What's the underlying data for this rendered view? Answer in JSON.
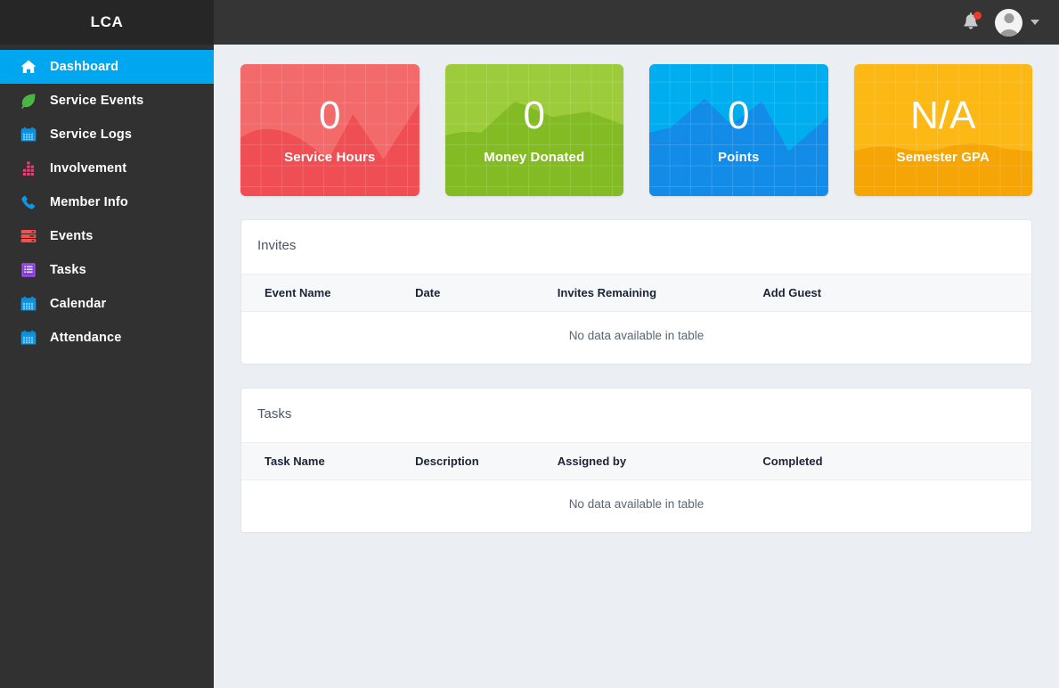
{
  "brand": {
    "name": "LCA"
  },
  "topbar": {
    "notifications_icon": "bell-icon",
    "has_unread": true,
    "avatar_icon": "user-avatar-icon",
    "dropdown_icon": "caret-down-icon"
  },
  "sidebar": {
    "items": [
      {
        "label": "Dashboard",
        "icon": "home-icon",
        "active": true
      },
      {
        "label": "Service Events",
        "icon": "leaf-icon",
        "active": false
      },
      {
        "label": "Service Logs",
        "icon": "calendar-icon",
        "active": false
      },
      {
        "label": "Involvement",
        "icon": "bar-chart-icon",
        "active": false
      },
      {
        "label": "Member Info",
        "icon": "phone-icon",
        "active": false
      },
      {
        "label": "Events",
        "icon": "server-icon",
        "active": false
      },
      {
        "label": "Tasks",
        "icon": "list-icon",
        "active": false
      },
      {
        "label": "Calendar",
        "icon": "calendar-icon",
        "active": false
      },
      {
        "label": "Attendance",
        "icon": "calendar-icon",
        "active": false
      }
    ]
  },
  "stat_cards": [
    {
      "value": "0",
      "label": "Service Hours",
      "color": "#f26a6a",
      "color_dark": "#ee4e54"
    },
    {
      "value": "0",
      "label": "Money Donated",
      "color": "#9ccc3c",
      "color_dark": "#83bb25"
    },
    {
      "value": "0",
      "label": "Points",
      "color": "#00aeef",
      "color_dark": "#138ce8"
    },
    {
      "value": "N/A",
      "label": "Semester GPA",
      "color": "#fcb814",
      "color_dark": "#f5a506"
    }
  ],
  "panels": [
    {
      "title": "Invites",
      "columns": [
        "Event Name",
        "Date",
        "Invites Remaining",
        "Add Guest"
      ],
      "empty_text": "No data available in table",
      "rows": []
    },
    {
      "title": "Tasks",
      "columns": [
        "Task Name",
        "Description",
        "Assigned by",
        "Completed"
      ],
      "empty_text": "No data available in table",
      "rows": []
    }
  ],
  "theme": {
    "sidebar_bg": "#313131",
    "brand_bg": "#262626",
    "topbar_bg": "#353535",
    "active_nav": "#00a7f0",
    "content_bg": "#ebeef2",
    "panel_bg": "#ffffff",
    "badge_red": "#f0392b"
  }
}
